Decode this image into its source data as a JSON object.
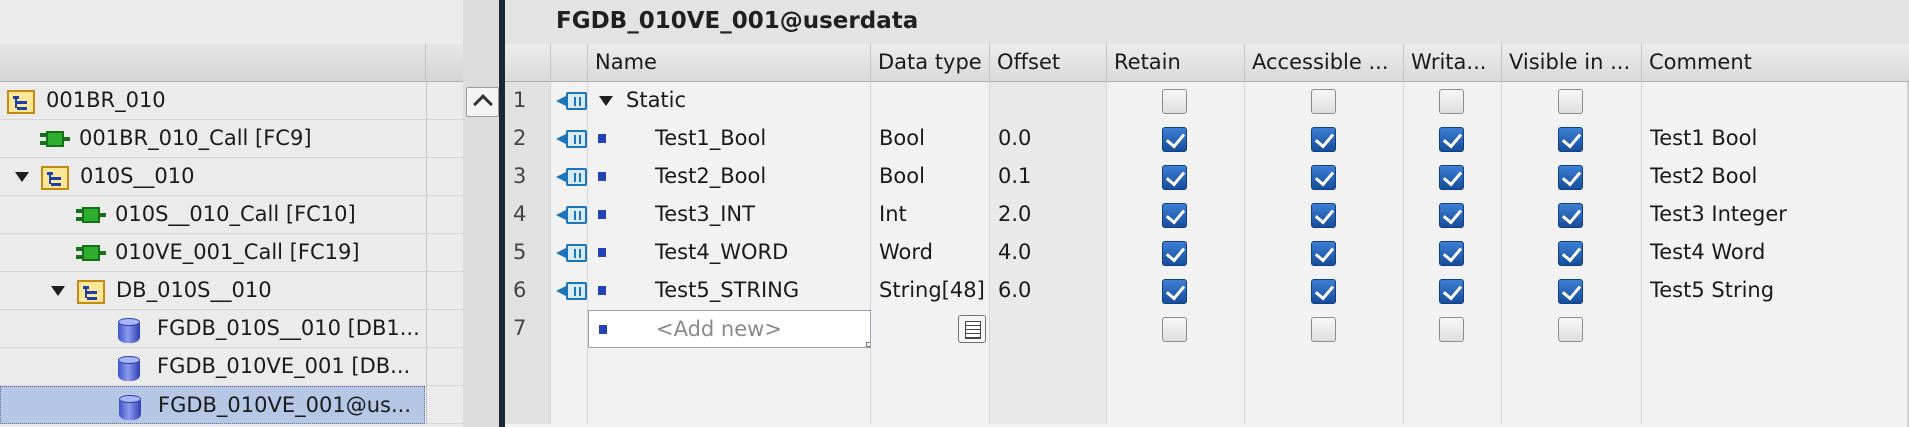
{
  "tree": {
    "items": [
      {
        "label": "001BR_010",
        "icon": "folder-icon",
        "expand": "",
        "level": 0
      },
      {
        "label": "001BR_010_Call [FC9]",
        "icon": "function-block-icon",
        "expand": "",
        "level": 1
      },
      {
        "label": "010S__010",
        "icon": "folder-icon",
        "expand": "collapse-arrow",
        "level": 0
      },
      {
        "label": "010S__010_Call [FC10]",
        "icon": "function-block-icon",
        "expand": "",
        "level": 2
      },
      {
        "label": "010VE_001_Call [FC19]",
        "icon": "function-block-icon",
        "expand": "",
        "level": 2
      },
      {
        "label": "DB_010S__010",
        "icon": "folder-icon",
        "expand": "collapse-arrow",
        "level": 1
      },
      {
        "label": "FGDB_010S__010 [DB1...",
        "icon": "database-icon",
        "expand": "",
        "level": 3
      },
      {
        "label": "FGDB_010VE_001 [DB...",
        "icon": "database-icon",
        "expand": "",
        "level": 3
      },
      {
        "label": "FGDB_010VE_001@us...",
        "icon": "database-icon",
        "expand": "",
        "level": 3,
        "selected": true
      }
    ]
  },
  "editor": {
    "title": "FGDB_010VE_001@userdata",
    "columns": {
      "name": "Name",
      "data_type": "Data type",
      "offset": "Offset",
      "retain": "Retain",
      "accessible": "Accessible ...",
      "writable": "Writa...",
      "visible": "Visible in ...",
      "comment": "Comment"
    },
    "rows": [
      {
        "num": "1",
        "name": "Static",
        "type": "",
        "offset": "",
        "comment": "",
        "checks": [
          false,
          false,
          false,
          false
        ],
        "kind": "section"
      },
      {
        "num": "2",
        "name": "Test1_Bool",
        "type": "Bool",
        "offset": "0.0",
        "comment": "Test1 Bool",
        "checks": [
          true,
          true,
          true,
          true
        ],
        "kind": "member"
      },
      {
        "num": "3",
        "name": "Test2_Bool",
        "type": "Bool",
        "offset": "0.1",
        "comment": "Test2 Bool",
        "checks": [
          true,
          true,
          true,
          true
        ],
        "kind": "member"
      },
      {
        "num": "4",
        "name": "Test3_INT",
        "type": "Int",
        "offset": "2.0",
        "comment": "Test3 Integer",
        "checks": [
          true,
          true,
          true,
          true
        ],
        "kind": "member"
      },
      {
        "num": "5",
        "name": "Test4_WORD",
        "type": "Word",
        "offset": "4.0",
        "comment": "Test4 Word",
        "checks": [
          true,
          true,
          true,
          true
        ],
        "kind": "member"
      },
      {
        "num": "6",
        "name": "Test5_STRING",
        "type": "String[48]",
        "offset": "6.0",
        "comment": "Test5 String",
        "checks": [
          true,
          true,
          true,
          true
        ],
        "kind": "member"
      },
      {
        "num": "7",
        "name": "<Add new>",
        "type": "",
        "offset": "",
        "comment": "",
        "checks": [
          false,
          false,
          false,
          false
        ],
        "kind": "add"
      }
    ]
  },
  "colors": {
    "selection": "#b6c7e6",
    "checkbox_checked": "#1f5fb5",
    "splitter": "#1c2833"
  }
}
